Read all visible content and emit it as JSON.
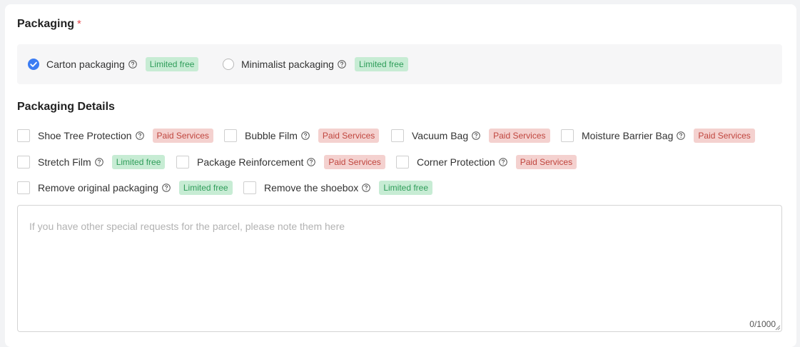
{
  "packaging": {
    "title": "Packaging",
    "required_mark": "*",
    "options": [
      {
        "label": "Carton packaging",
        "tag": "Limited free",
        "selected": true
      },
      {
        "label": "Minimalist packaging",
        "tag": "Limited free",
        "selected": false
      }
    ]
  },
  "details": {
    "title": "Packaging Details",
    "items": [
      {
        "label": "Shoe Tree Protection",
        "tag": "Paid Services",
        "tag_type": "paid",
        "checked": false
      },
      {
        "label": "Bubble Film",
        "tag": "Paid Services",
        "tag_type": "paid",
        "checked": false
      },
      {
        "label": "Vacuum Bag",
        "tag": "Paid Services",
        "tag_type": "paid",
        "checked": false
      },
      {
        "label": "Moisture Barrier Bag",
        "tag": "Paid Services",
        "tag_type": "paid",
        "checked": false
      },
      {
        "label": "Stretch Film",
        "tag": "Limited free",
        "tag_type": "free",
        "checked": false
      },
      {
        "label": "Package Reinforcement",
        "tag": "Paid Services",
        "tag_type": "paid",
        "checked": false
      },
      {
        "label": "Corner Protection",
        "tag": "Paid Services",
        "tag_type": "paid",
        "checked": false
      },
      {
        "label": "Remove original packaging",
        "tag": "Limited free",
        "tag_type": "free",
        "checked": false
      },
      {
        "label": "Remove the shoebox",
        "tag": "Limited free",
        "tag_type": "free",
        "checked": false
      }
    ]
  },
  "notes": {
    "placeholder": "If you have other special requests for the parcel, please note them here",
    "value": "",
    "counter": "0/1000"
  },
  "colors": {
    "accent": "#3b7cf3",
    "free_tag_bg": "#c7ecd4",
    "free_tag_text": "#2f9d5a",
    "paid_tag_bg": "#f4d1cf",
    "paid_tag_text": "#c0463f",
    "required": "#e5484d"
  },
  "icons": {
    "help": "question-circle-icon",
    "selected": "check-circle-icon"
  }
}
